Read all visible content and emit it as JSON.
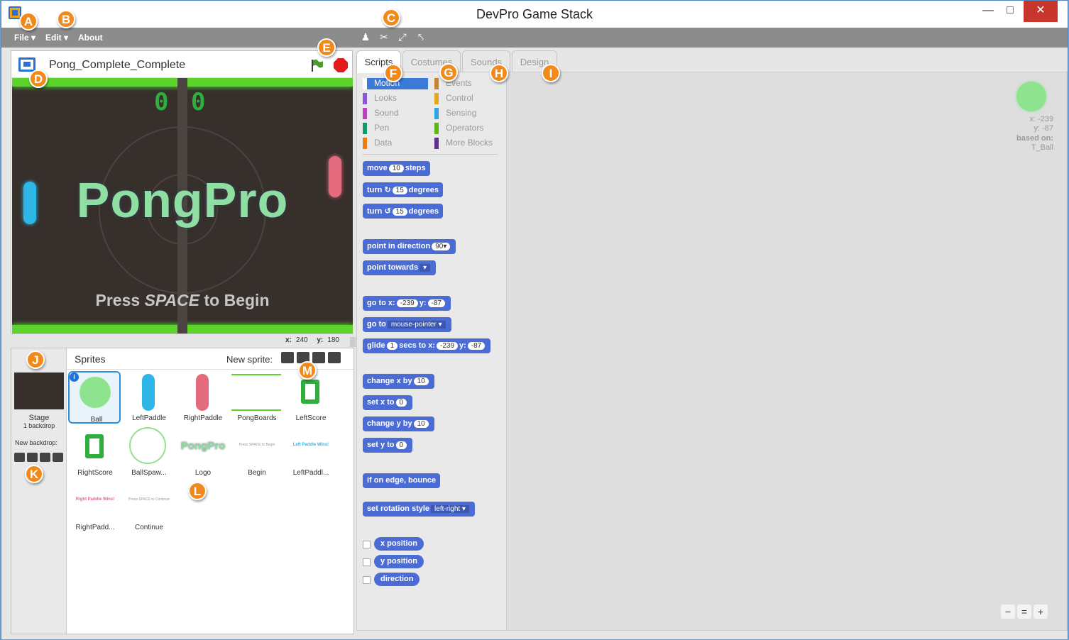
{
  "window": {
    "title": "DevPro Game Stack"
  },
  "menu": {
    "file": "File",
    "edit": "Edit",
    "about": "About"
  },
  "toolbar": {
    "icons": [
      "duplicate-icon",
      "cut-icon",
      "grow-icon",
      "shrink-icon"
    ]
  },
  "stage": {
    "project_name": "Pong_Complete_Complete",
    "score_left": "0",
    "score_right": "0",
    "logo_text": "PongPro",
    "press_pre": "Press ",
    "press_key": "SPACE",
    "press_post": " to Begin",
    "x_label": "x:",
    "x_value": "240",
    "y_label": "y:",
    "y_value": "180"
  },
  "sprites": {
    "title": "Sprites",
    "new_sprite_label": "New sprite:",
    "stage_label": "Stage",
    "stage_backdrops": "1 backdrop",
    "new_backdrop_label": "New backdrop:",
    "items": [
      {
        "name": "Ball"
      },
      {
        "name": "LeftPaddle"
      },
      {
        "name": "RightPaddle"
      },
      {
        "name": "PongBoards"
      },
      {
        "name": "LeftScore"
      },
      {
        "name": "RightScore"
      },
      {
        "name": "BallSpaw..."
      },
      {
        "name": "Logo"
      },
      {
        "name": "Begin"
      },
      {
        "name": "LeftPaddl..."
      },
      {
        "name": "RightPadd..."
      },
      {
        "name": "Continue"
      }
    ],
    "thumb_texts": {
      "logo": "PongPro",
      "begin": "Press SPACE to Begin",
      "leftwin": "Left Paddle Wins!",
      "rightwin": "Right Paddle Wins!",
      "continue": "Press SPACE to Continue"
    }
  },
  "tabs": [
    "Scripts",
    "Costumes",
    "Sounds",
    "Design"
  ],
  "categories": [
    {
      "label": "Motion",
      "color": "#4a6cd4"
    },
    {
      "label": "Events",
      "color": "#c88330"
    },
    {
      "label": "Looks",
      "color": "#8a55d7"
    },
    {
      "label": "Control",
      "color": "#e1a91a"
    },
    {
      "label": "Sound",
      "color": "#bb42c3"
    },
    {
      "label": "Sensing",
      "color": "#2ca5e2"
    },
    {
      "label": "Pen",
      "color": "#0e9a6c"
    },
    {
      "label": "Operators",
      "color": "#5cb712"
    },
    {
      "label": "Data",
      "color": "#ee7d16"
    },
    {
      "label": "More Blocks",
      "color": "#632d99"
    }
  ],
  "blocks": {
    "move": {
      "pre": "move",
      "val": "10",
      "post": "steps"
    },
    "turn_cw": {
      "pre": "turn",
      "val": "15",
      "post": "degrees"
    },
    "turn_ccw": {
      "pre": "turn",
      "val": "15",
      "post": "degrees"
    },
    "point_dir": {
      "pre": "point in direction",
      "val": "90"
    },
    "point_towards": {
      "pre": "point towards"
    },
    "goto_xy": {
      "pre": "go to x:",
      "x": "-239",
      "mid": "y:",
      "y": "-87"
    },
    "goto": {
      "pre": "go to",
      "val": "mouse-pointer"
    },
    "glide": {
      "pre": "glide",
      "val": "1",
      "mid": "secs to x:",
      "x": "-239",
      "mid2": "y:",
      "y": "-87"
    },
    "change_x": {
      "pre": "change x by",
      "val": "10"
    },
    "set_x": {
      "pre": "set x to",
      "val": "0"
    },
    "change_y": {
      "pre": "change y by",
      "val": "10"
    },
    "set_y": {
      "pre": "set y to",
      "val": "0"
    },
    "bounce": {
      "pre": "if on edge, bounce"
    },
    "rotation": {
      "pre": "set rotation style",
      "val": "left-right"
    },
    "reporters": [
      "x position",
      "y position",
      "direction"
    ]
  },
  "sprite_info": {
    "x": "x: -239",
    "y": "y: -87",
    "based_on": "based on:",
    "costume": "T_Ball"
  },
  "annotations": [
    "A",
    "B",
    "C",
    "D",
    "E",
    "F",
    "G",
    "H",
    "I",
    "J",
    "K",
    "L",
    "M"
  ]
}
